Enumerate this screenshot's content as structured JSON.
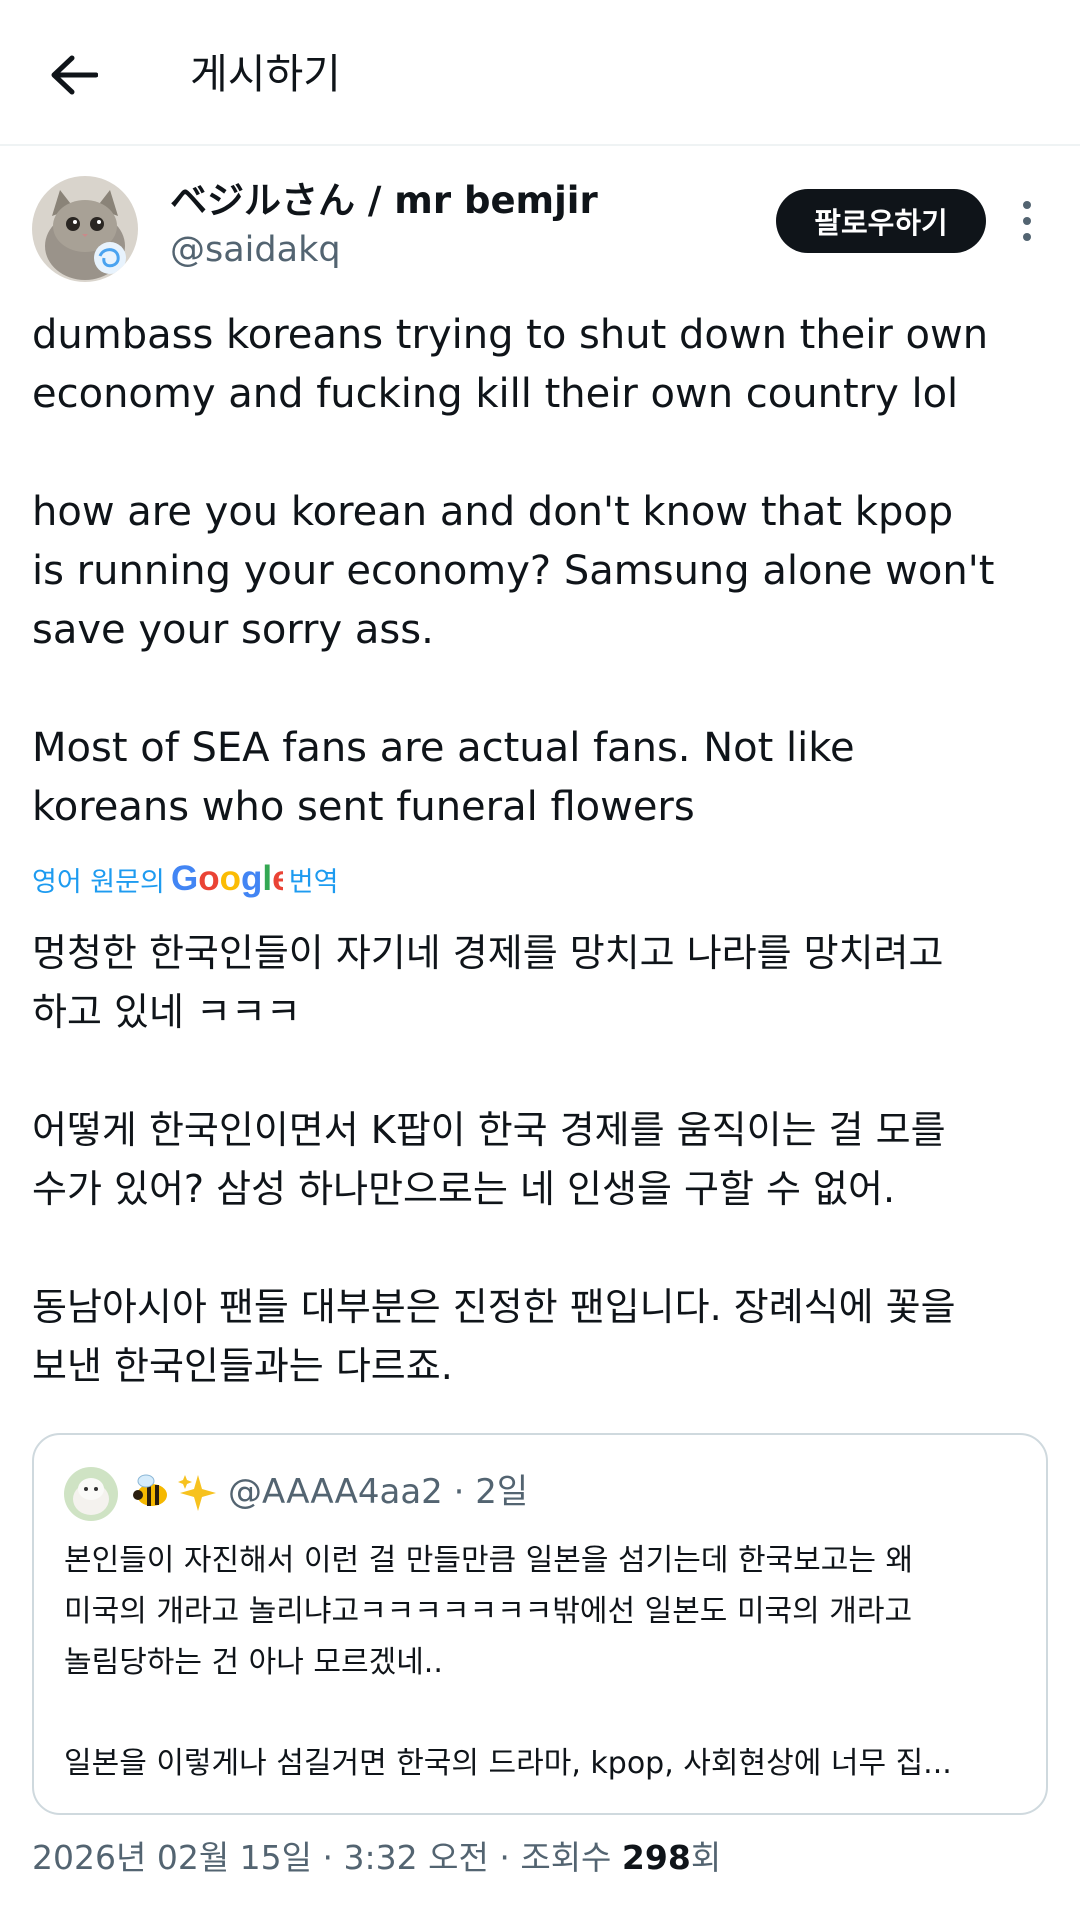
{
  "header": {
    "title": "게시하기",
    "back_icon": "arrow-left-icon"
  },
  "tweet": {
    "author_name": "ベジルさん / mr bemjir",
    "author_handle": "@saidakq",
    "follow_label": "팔로우하기",
    "text": "dumbass koreans trying to shut down their own\neconomy and fucking kill their own country lol\n\nhow are you korean and don't know that kpop\nis running your economy? Samsung alone won't\nsave your sorry ass.\n\nMost of SEA fans are actual fans. Not like\nkoreans who sent funeral flowers",
    "translate_prefix": "영어 원문의",
    "translate_suffix": "번역",
    "translated_text": "멍청한 한국인들이 자기네 경제를 망치고 나라를 망치려고\n하고 있네 ㅋㅋㅋ\n\n어떻게 한국인이면서 K팝이 한국 경제를 움직이는 걸 모를\n수가 있어? 삼성 하나만으로는 네 인생을 구할 수 없어.\n\n동남아시아 팬들 대부분은 진정한 팬입니다. 장례식에 꽃을\n보낸 한국인들과는 다르죠."
  },
  "quote": {
    "emoji": "🐝✨",
    "handle": "@AAAA4aa2",
    "separator": " · ",
    "time": "2일",
    "text": "본인들이 자진해서 이런 걸 만들만큼 일본을 섬기는데 한국보고는 왜\n미국의 개라고 놀리냐고ㅋㅋㅋㅋㅋㅋㅋ밖에선 일본도 미국의 개라고\n놀림당하는 건 아나 모르겠네..",
    "text_last": "일본을 이렇게나 섬길거면 한국의 드라마, kpop, 사회현상에 너무 집..."
  },
  "meta": {
    "date": "2026년 02월 15일",
    "sep": " · ",
    "time": "3:32 오전",
    "views_label": "조회수",
    "views_count": "298",
    "views_suffix": "회"
  }
}
